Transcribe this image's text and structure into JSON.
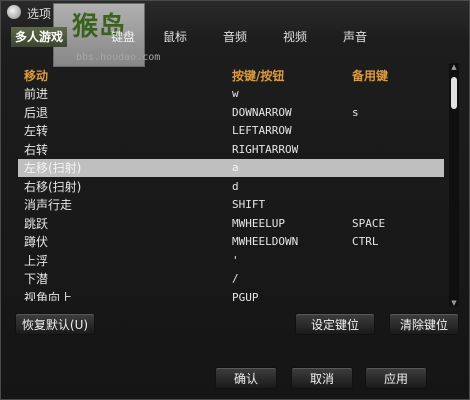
{
  "window": {
    "title": "选项"
  },
  "branding": {
    "logo_text": "猴岛",
    "watermark": "bbs.houdao.com"
  },
  "tabs": [
    {
      "label": "多人游戏"
    },
    {
      "label": "键盘"
    },
    {
      "label": "鼠标"
    },
    {
      "label": "音频"
    },
    {
      "label": "视频"
    },
    {
      "label": "声音"
    }
  ],
  "keybinds": {
    "columns": [
      "移动",
      "按键/按钮",
      "备用键"
    ],
    "rows": [
      {
        "action": "前进",
        "key": "w",
        "alt": ""
      },
      {
        "action": "后退",
        "key": "DOWNARROW",
        "alt": "s"
      },
      {
        "action": "左转",
        "key": "LEFTARROW",
        "alt": ""
      },
      {
        "action": "右转",
        "key": "RIGHTARROW",
        "alt": ""
      },
      {
        "action": "左移(扫射)",
        "key": "a",
        "alt": ""
      },
      {
        "action": "右移(扫射)",
        "key": "d",
        "alt": ""
      },
      {
        "action": "消声行走",
        "key": "SHIFT",
        "alt": ""
      },
      {
        "action": "跳跃",
        "key": "MWHEELUP",
        "alt": "SPACE"
      },
      {
        "action": "蹲伏",
        "key": "MWHEELDOWN",
        "alt": "CTRL"
      },
      {
        "action": "上浮",
        "key": "'",
        "alt": ""
      },
      {
        "action": "下潜",
        "key": "/",
        "alt": ""
      },
      {
        "action": "视角向上",
        "key": "PGUP",
        "alt": ""
      }
    ],
    "selected_index": 4
  },
  "buttons": {
    "reset": "恢复默认(U)",
    "set_key": "设定键位",
    "clear_key": "清除键位",
    "ok": "确认",
    "cancel": "取消",
    "apply": "应用"
  }
}
